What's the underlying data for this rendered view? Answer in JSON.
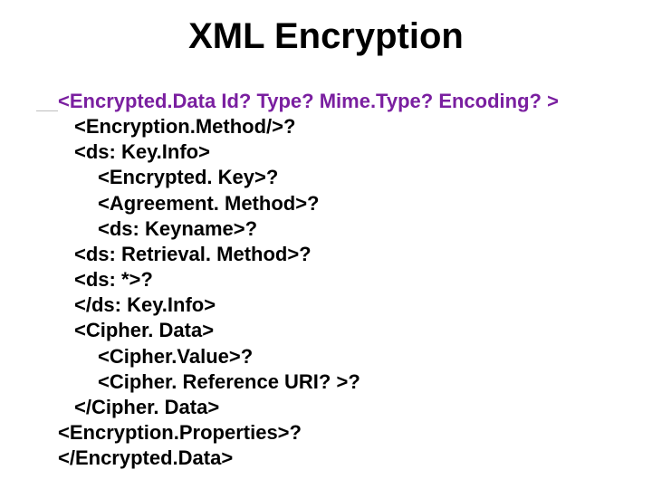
{
  "title": "XML Encryption",
  "lines": [
    {
      "cls": "l0 purple",
      "text": "<Encrypted.Data Id? Type? Mime.Type? Encoding? >"
    },
    {
      "cls": "l1",
      "text": "<Encryption.Method/>?"
    },
    {
      "cls": "l1",
      "text": "<ds: Key.Info>"
    },
    {
      "cls": "l2",
      "text": "<Encrypted. Key>?"
    },
    {
      "cls": "l2",
      "text": "<Agreement. Method>?"
    },
    {
      "cls": "l2",
      "text": "<ds: Keyname>?"
    },
    {
      "cls": "l1",
      "text": "<ds: Retrieval. Method>?"
    },
    {
      "cls": "l1",
      "text": "<ds: *>?"
    },
    {
      "cls": "l1",
      "text": "</ds: Key.Info>"
    },
    {
      "cls": "l1",
      "text": "<Cipher. Data>"
    },
    {
      "cls": "l2",
      "text": "<Cipher.Value>?"
    },
    {
      "cls": "l2",
      "text": "<Cipher. Reference URI? >?"
    },
    {
      "cls": "l1",
      "text": "</Cipher. Data>"
    },
    {
      "cls": "l0",
      "text": "<Encryption.Properties>?"
    },
    {
      "cls": "l0",
      "text": "</Encrypted.Data>"
    }
  ]
}
